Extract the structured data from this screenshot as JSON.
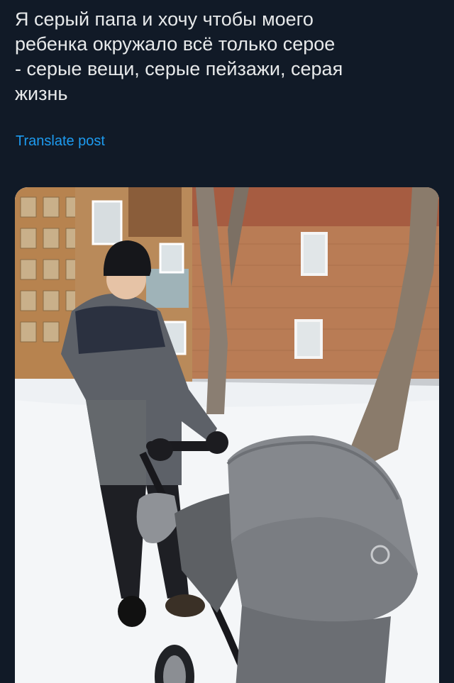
{
  "post": {
    "text": "Я серый папа и хочу чтобы моего\nребенка окружало всё только серое\n- серые вещи, серые пейзажи, серая\nжизнь",
    "translate_label": "Translate post"
  },
  "photo": {
    "description_icon": "photo-icon"
  },
  "colors": {
    "background": "#111a27",
    "text": "#e7e9ea",
    "link": "#1d9bf0"
  }
}
